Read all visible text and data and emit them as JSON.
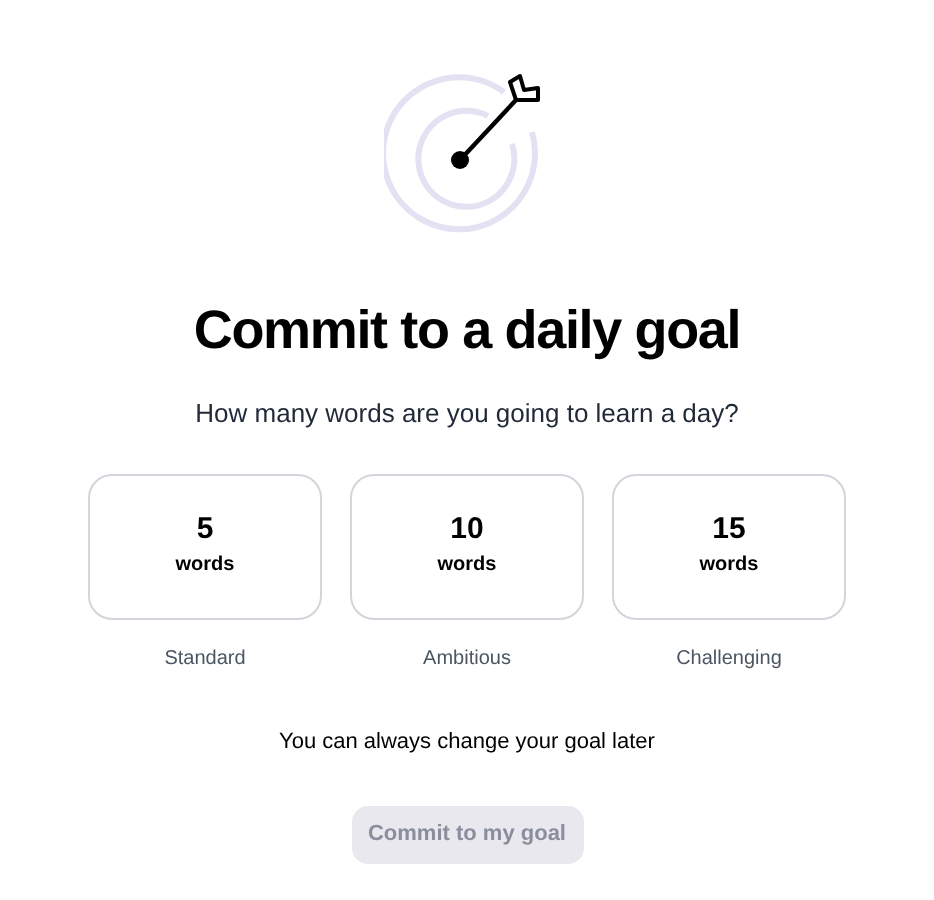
{
  "title": "Commit to a daily goal",
  "subtitle": "How many words are you going to learn a day?",
  "options": [
    {
      "count": "5",
      "unit": "words",
      "label": "Standard",
      "selected": false
    },
    {
      "count": "10",
      "unit": "words",
      "label": "Ambitious",
      "selected": false
    },
    {
      "count": "15",
      "unit": "words",
      "label": "Challenging",
      "selected": false
    }
  ],
  "note": "You can always change your goal later",
  "button": {
    "label": "Commit to my goal",
    "disabled": true
  }
}
